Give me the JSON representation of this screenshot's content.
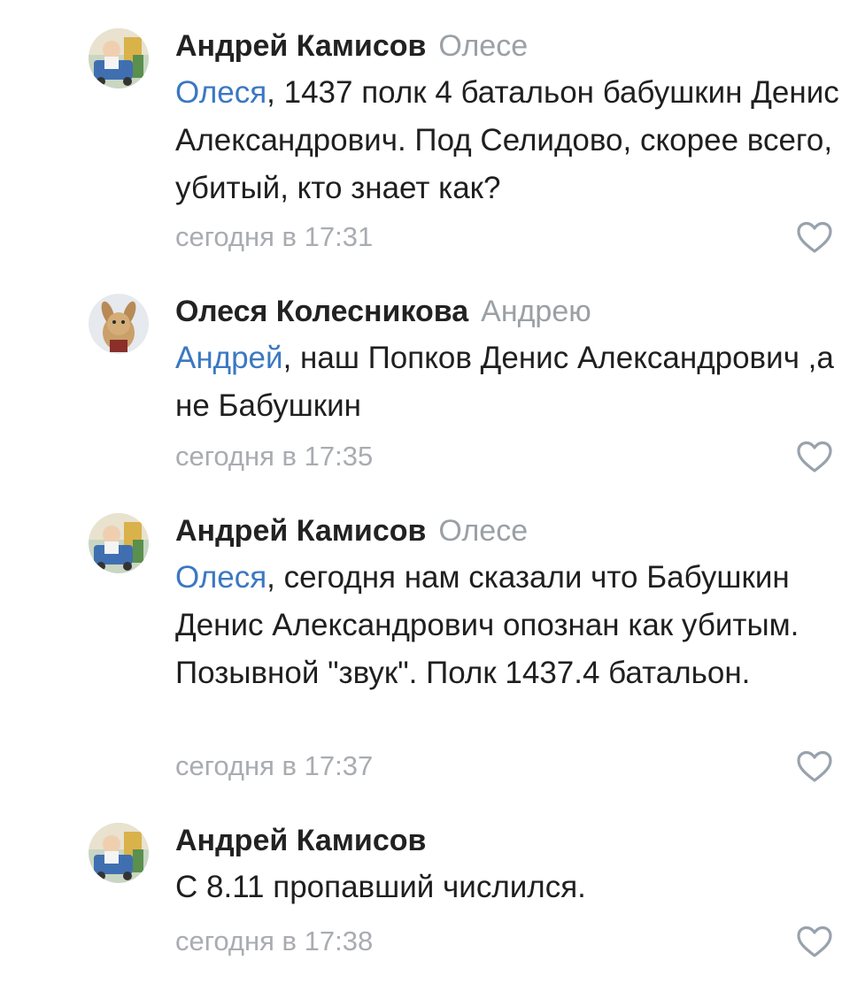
{
  "comments": [
    {
      "author": "Андрей Камисов",
      "reply_to": "Олесе",
      "mention": "Олеся",
      "text": ", 1437 полк 4 батальон бабушкин Денис Александрович. Под Селидово, скорее всего, убитый, кто знает как?",
      "time": "сегодня в 17:31",
      "avatar_icon": "child-photo-avatar",
      "like_icon": "heart-outline-icon"
    },
    {
      "author": "Олеся Колесникова",
      "reply_to": "Андрею",
      "mention": "Андрей",
      "text": ", наш Попков Денис Александрович ,а не Бабушкин",
      "time": "сегодня в 17:35",
      "avatar_icon": "plush-toy-avatar",
      "like_icon": "heart-outline-icon"
    },
    {
      "author": "Андрей Камисов",
      "reply_to": "Олесе",
      "mention": "Олеся",
      "text": ", сегодня нам сказали что Бабушкин Денис Александрович опознан как убитым. Позывной \"звук\". Полк 1437.4 батальон.",
      "time": "сегодня в 17:37",
      "avatar_icon": "child-photo-avatar",
      "like_icon": "heart-outline-icon"
    },
    {
      "author": "Андрей Камисов",
      "reply_to": "",
      "mention": "",
      "text": "С 8.11 пропавший числился.",
      "time": "сегодня в 17:38",
      "avatar_icon": "child-photo-avatar",
      "like_icon": "heart-outline-icon"
    }
  ],
  "colors": {
    "mention": "#3b78c2",
    "secondary_text": "#9aa0a6",
    "primary_text": "#222222",
    "like_icon": "#99a2ad"
  }
}
